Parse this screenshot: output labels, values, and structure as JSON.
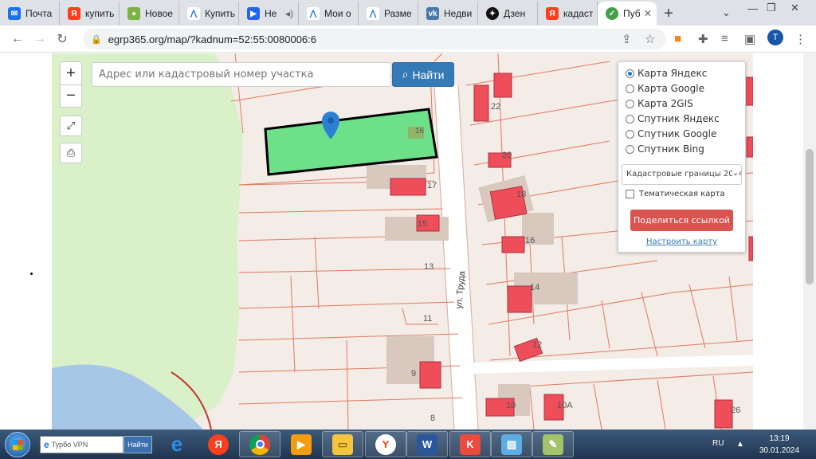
{
  "browser": {
    "tabs": [
      {
        "label": "Почта",
        "icon": "mail-icon",
        "color": "#1a73e8"
      },
      {
        "label": "купить",
        "icon": "yandex-icon",
        "color": "#fc3f1d"
      },
      {
        "label": "Новое",
        "icon": "app-icon",
        "color": "#7cb342"
      },
      {
        "label": "Купить",
        "icon": "avito-icon",
        "color": "#1f6fe5"
      },
      {
        "label": "Не",
        "icon": "video-icon",
        "color": "#2563eb"
      },
      {
        "label": "Мои о",
        "icon": "avito-icon",
        "color": "#1f6fe5"
      },
      {
        "label": "Разме",
        "icon": "avito-icon",
        "color": "#1f6fe5"
      },
      {
        "label": "Недви",
        "icon": "vk-icon",
        "color": "#4a76a8"
      },
      {
        "label": "Дзен",
        "icon": "dzen-icon",
        "color": "#111111"
      },
      {
        "label": "кадаст",
        "icon": "yandex-icon",
        "color": "#fc3f1d"
      },
      {
        "label": "Пуб",
        "icon": "check-icon",
        "color": "#43a047",
        "active": true
      }
    ],
    "url": "egrp365.org/map/?kadnum=52:55:0080006:6",
    "profile_initial": "T"
  },
  "map": {
    "search_placeholder": "Адрес или кадастровый номер участка",
    "search_button": "Найти",
    "zoom_in": "+",
    "zoom_out": "−",
    "layers": [
      {
        "label": "Карта Яндекс",
        "selected": true
      },
      {
        "label": "Карта Google",
        "selected": false
      },
      {
        "label": "Карта 2GIS",
        "selected": false
      },
      {
        "label": "Спутник Яндекс",
        "selected": false
      },
      {
        "label": "Спутник Google",
        "selected": false
      },
      {
        "label": "Спутник Bing",
        "selected": false
      }
    ],
    "boundary_select": "Кадастровые границы 2024",
    "thematic_label": "Тематическая карта",
    "share_button": "Поделиться ссылкой",
    "configure_link": "Настроить карту",
    "street_label": "ул. Труда",
    "house_numbers": [
      "22",
      "20",
      "18",
      "17",
      "16",
      "15",
      "14",
      "13",
      "12",
      "11",
      "10",
      "10А",
      "9",
      "8",
      "16",
      "26"
    ],
    "colors": {
      "parcel": "#6ee08a",
      "building": "#ee4d5a",
      "boundary": "#e07a5f",
      "greenery": "#d9f0c9",
      "water": "#a7c7e7"
    }
  },
  "taskbar": {
    "search_placeholder": "Турбо VPN",
    "search_button": "Найти",
    "language": "RU",
    "time": "13:19",
    "date": "30.01.2024"
  }
}
